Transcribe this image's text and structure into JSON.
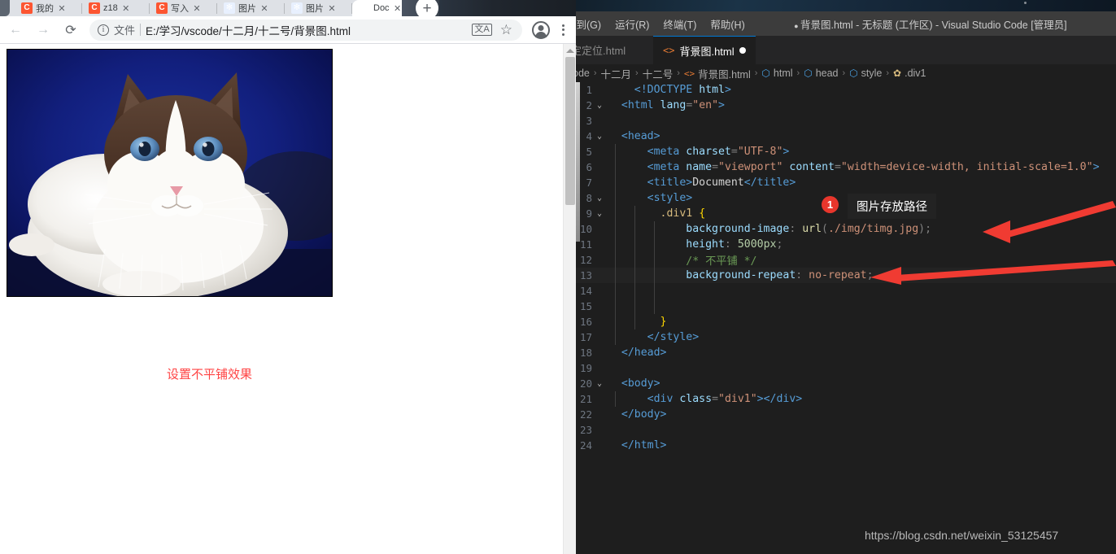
{
  "browser": {
    "tabs": [
      {
        "label": "我的",
        "icon": "csdn-favicon",
        "favclass": "fav-csdn",
        "letter": "C",
        "active": false
      },
      {
        "label": "z18",
        "icon": "csdn-favicon",
        "favclass": "fav-csdn",
        "letter": "C",
        "active": false
      },
      {
        "label": "写入",
        "icon": "csdn-favicon",
        "favclass": "fav-csdn",
        "letter": "C",
        "active": false
      },
      {
        "label": "图片",
        "icon": "baidu-favicon",
        "favclass": "fav-baidu",
        "letter": "✻",
        "active": false
      },
      {
        "label": "图片",
        "icon": "baidu-favicon",
        "favclass": "fav-baidu",
        "letter": "✻",
        "active": false
      },
      {
        "label": "Doc",
        "icon": "chrome-favicon",
        "favclass": "fav-doc",
        "letter": "◔",
        "active": true
      }
    ],
    "new_tab_label": "+",
    "close_glyph": "✕",
    "nav": {
      "back": "←",
      "forward": "→",
      "reload": "⟳"
    },
    "omnibox": {
      "info_glyph": "i",
      "scheme_label": "文件",
      "url": "E:/学习/vscode/十二月/十二号/背景图.html",
      "translate_icon": "文A",
      "bookmark_icon": "☆"
    },
    "page": {
      "red_note": "设置不平铺效果",
      "image_alt": "ragdoll-cat-photo"
    }
  },
  "vscode": {
    "menu": [
      "转到(G)",
      "运行(R)",
      "终端(T)",
      "帮助(H)"
    ],
    "window_title": "背景图.html - 无标题 (工作区) - Visual Studio Code [管理员]",
    "dirty_marker": "●",
    "tabs": [
      {
        "label": "定定位.html",
        "active": false,
        "dirty": false
      },
      {
        "label": "背景图.html",
        "active": true,
        "dirty": true
      }
    ],
    "breadcrumb": [
      "ode",
      "十二月",
      "十二号",
      "背景图.html",
      "html",
      "head",
      "style",
      ".div1"
    ],
    "code_lines": [
      {
        "num": "1",
        "chevron": "",
        "current": false,
        "tokens": [
          {
            "t": "    ",
            "c": "t-txt"
          },
          {
            "t": "<!DOCTYPE",
            "c": "t-tag"
          },
          {
            "t": " ",
            "c": "t-txt"
          },
          {
            "t": "html",
            "c": "t-attr"
          },
          {
            "t": ">",
            "c": "t-tag"
          }
        ]
      },
      {
        "num": "2",
        "chevron": "⌄",
        "current": false,
        "tokens": [
          {
            "t": "  ",
            "c": "t-txt"
          },
          {
            "t": "<html",
            "c": "t-tag"
          },
          {
            "t": " ",
            "c": "t-txt"
          },
          {
            "t": "lang",
            "c": "t-attr"
          },
          {
            "t": "=",
            "c": "t-punc"
          },
          {
            "t": "\"en\"",
            "c": "t-str"
          },
          {
            "t": ">",
            "c": "t-tag"
          }
        ]
      },
      {
        "num": "3",
        "chevron": "",
        "current": false,
        "tokens": []
      },
      {
        "num": "4",
        "chevron": "⌄",
        "current": false,
        "tokens": [
          {
            "t": "  ",
            "c": "t-txt"
          },
          {
            "t": "<head>",
            "c": "t-tag"
          }
        ]
      },
      {
        "num": "5",
        "chevron": "",
        "current": false,
        "tokens": [
          {
            "t": "      ",
            "c": "t-txt"
          },
          {
            "t": "<meta",
            "c": "t-tag"
          },
          {
            "t": " ",
            "c": "t-txt"
          },
          {
            "t": "charset",
            "c": "t-attr"
          },
          {
            "t": "=",
            "c": "t-punc"
          },
          {
            "t": "\"UTF-8\"",
            "c": "t-str"
          },
          {
            "t": ">",
            "c": "t-tag"
          }
        ]
      },
      {
        "num": "6",
        "chevron": "",
        "current": false,
        "tokens": [
          {
            "t": "      ",
            "c": "t-txt"
          },
          {
            "t": "<meta",
            "c": "t-tag"
          },
          {
            "t": " ",
            "c": "t-txt"
          },
          {
            "t": "name",
            "c": "t-attr"
          },
          {
            "t": "=",
            "c": "t-punc"
          },
          {
            "t": "\"viewport\"",
            "c": "t-str"
          },
          {
            "t": " ",
            "c": "t-txt"
          },
          {
            "t": "content",
            "c": "t-attr"
          },
          {
            "t": "=",
            "c": "t-punc"
          },
          {
            "t": "\"width=device-width, initial-scale=1.0\"",
            "c": "t-str"
          },
          {
            "t": ">",
            "c": "t-tag"
          }
        ]
      },
      {
        "num": "7",
        "chevron": "",
        "current": false,
        "tokens": [
          {
            "t": "      ",
            "c": "t-txt"
          },
          {
            "t": "<title>",
            "c": "t-tag"
          },
          {
            "t": "Document",
            "c": "t-txt"
          },
          {
            "t": "</title>",
            "c": "t-tag"
          }
        ]
      },
      {
        "num": "8",
        "chevron": "⌄",
        "current": false,
        "tokens": [
          {
            "t": "      ",
            "c": "t-txt"
          },
          {
            "t": "<style>",
            "c": "t-tag"
          }
        ]
      },
      {
        "num": "9",
        "chevron": "⌄",
        "current": false,
        "tokens": [
          {
            "t": "        ",
            "c": "t-txt"
          },
          {
            "t": ".div1",
            "c": "t-sel"
          },
          {
            "t": " ",
            "c": "t-txt"
          },
          {
            "t": "{",
            "c": "t-brace"
          }
        ]
      },
      {
        "num": "10",
        "chevron": "",
        "current": false,
        "tokens": [
          {
            "t": "            ",
            "c": "t-txt"
          },
          {
            "t": "background-image",
            "c": "t-prop"
          },
          {
            "t": ": ",
            "c": "t-punc"
          },
          {
            "t": "url",
            "c": "t-fn"
          },
          {
            "t": "(",
            "c": "t-punc"
          },
          {
            "t": "./img/timg.jpg",
            "c": "t-val"
          },
          {
            "t": ")",
            "c": "t-punc"
          },
          {
            "t": ";",
            "c": "t-punc"
          }
        ]
      },
      {
        "num": "11",
        "chevron": "",
        "current": false,
        "tokens": [
          {
            "t": "            ",
            "c": "t-txt"
          },
          {
            "t": "height",
            "c": "t-prop"
          },
          {
            "t": ": ",
            "c": "t-punc"
          },
          {
            "t": "5000px",
            "c": "t-num"
          },
          {
            "t": ";",
            "c": "t-punc"
          }
        ]
      },
      {
        "num": "12",
        "chevron": "",
        "current": false,
        "tokens": [
          {
            "t": "            ",
            "c": "t-txt"
          },
          {
            "t": "/* 不平铺 */",
            "c": "t-com"
          }
        ]
      },
      {
        "num": "13",
        "chevron": "",
        "current": true,
        "tokens": [
          {
            "t": "            ",
            "c": "t-txt"
          },
          {
            "t": "background-repeat",
            "c": "t-prop"
          },
          {
            "t": ": ",
            "c": "t-punc"
          },
          {
            "t": "no-repeat",
            "c": "t-val"
          },
          {
            "t": ";",
            "c": "t-punc"
          }
        ]
      },
      {
        "num": "14",
        "chevron": "",
        "current": false,
        "tokens": []
      },
      {
        "num": "15",
        "chevron": "",
        "current": false,
        "tokens": []
      },
      {
        "num": "16",
        "chevron": "",
        "current": false,
        "tokens": [
          {
            "t": "        ",
            "c": "t-txt"
          },
          {
            "t": "}",
            "c": "t-brace"
          }
        ]
      },
      {
        "num": "17",
        "chevron": "",
        "current": false,
        "tokens": [
          {
            "t": "      ",
            "c": "t-txt"
          },
          {
            "t": "</style>",
            "c": "t-tag"
          }
        ]
      },
      {
        "num": "18",
        "chevron": "",
        "current": false,
        "tokens": [
          {
            "t": "  ",
            "c": "t-txt"
          },
          {
            "t": "</head>",
            "c": "t-tag"
          }
        ]
      },
      {
        "num": "19",
        "chevron": "",
        "current": false,
        "tokens": []
      },
      {
        "num": "20",
        "chevron": "⌄",
        "current": false,
        "tokens": [
          {
            "t": "  ",
            "c": "t-txt"
          },
          {
            "t": "<body>",
            "c": "t-tag"
          }
        ]
      },
      {
        "num": "21",
        "chevron": "",
        "current": false,
        "tokens": [
          {
            "t": "      ",
            "c": "t-txt"
          },
          {
            "t": "<div",
            "c": "t-tag"
          },
          {
            "t": " ",
            "c": "t-txt"
          },
          {
            "t": "class",
            "c": "t-attr"
          },
          {
            "t": "=",
            "c": "t-punc"
          },
          {
            "t": "\"div1\"",
            "c": "t-str"
          },
          {
            "t": ">",
            "c": "t-tag"
          },
          {
            "t": "</div>",
            "c": "t-tag"
          }
        ]
      },
      {
        "num": "22",
        "chevron": "",
        "current": false,
        "tokens": [
          {
            "t": "  ",
            "c": "t-txt"
          },
          {
            "t": "</body>",
            "c": "t-tag"
          }
        ]
      },
      {
        "num": "23",
        "chevron": "",
        "current": false,
        "tokens": []
      },
      {
        "num": "24",
        "chevron": "",
        "current": false,
        "tokens": [
          {
            "t": "  ",
            "c": "t-txt"
          },
          {
            "t": "</html>",
            "c": "t-tag"
          }
        ]
      }
    ]
  },
  "annotations": {
    "badge1_number": "1",
    "tooltip1_text": "图片存放路径",
    "arrow_color": "#f03b32",
    "badge_color": "#e8362c"
  },
  "watermark": "https://blog.csdn.net/weixin_53125457"
}
